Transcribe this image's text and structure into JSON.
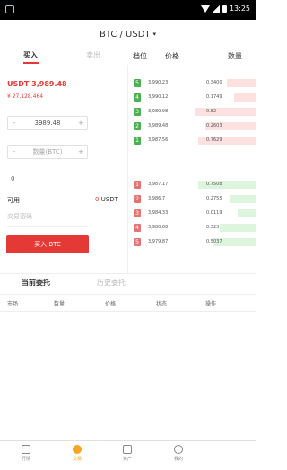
{
  "status_bar": {
    "time": "13:25"
  },
  "header": {
    "pair": "BTC / USDT",
    "caret": "▾"
  },
  "trade": {
    "tabs": {
      "buy": "买入",
      "sell": "卖出"
    },
    "last_price": "USDT 3,989.48",
    "last_price_cny": "¥ 27,128.464",
    "price_input": {
      "minus": "-",
      "value": "3989.48",
      "plus": "+"
    },
    "qty_input": {
      "minus": "-",
      "placeholder": "数量(BTC)",
      "plus": "+"
    },
    "slider_value": "0",
    "available_label": "可用",
    "available_value": "0",
    "available_unit": "USDT",
    "password_placeholder": "交易密码",
    "buy_button": "买入 BTC"
  },
  "orderbook": {
    "headers": {
      "level": "档位",
      "price": "价格",
      "qty": "数量"
    },
    "asks": [
      {
        "idx": "5",
        "price": "3,990.23",
        "qty": "0.3400",
        "depth": 0.4
      },
      {
        "idx": "4",
        "price": "3,990.12",
        "qty": "0.1749",
        "depth": 0.3
      },
      {
        "idx": "3",
        "price": "3,989.98",
        "qty": "0.82",
        "depth": 0.85
      },
      {
        "idx": "2",
        "price": "3,989.48",
        "qty": "0.2603",
        "depth": 0.7
      },
      {
        "idx": "1",
        "price": "3,987.56",
        "qty": "0.7629",
        "depth": 0.8
      }
    ],
    "bids": [
      {
        "idx": "1",
        "price": "3,987.17",
        "qty": "0.7508",
        "depth": 0.8
      },
      {
        "idx": "2",
        "price": "3,986.7",
        "qty": "0.2755",
        "depth": 0.35
      },
      {
        "idx": "3",
        "price": "3,984.33",
        "qty": "0.0119",
        "depth": 0.25
      },
      {
        "idx": "4",
        "price": "3,980.68",
        "qty": "0.323",
        "depth": 0.5
      },
      {
        "idx": "5",
        "price": "3,979.87",
        "qty": "0.5037",
        "depth": 0.6
      }
    ]
  },
  "orders": {
    "tab_current": "当前委托",
    "tab_history": "历史委托",
    "columns": [
      "市场",
      "数量",
      "价格",
      "状态",
      "操作"
    ]
  },
  "tabbar": {
    "items": [
      {
        "label": "行情"
      },
      {
        "label": "交易"
      },
      {
        "label": "资产"
      },
      {
        "label": "我的"
      }
    ]
  },
  "colors": {
    "accent_red": "#e53935",
    "green": "#4caf50",
    "active_tab": "#f5a623"
  }
}
